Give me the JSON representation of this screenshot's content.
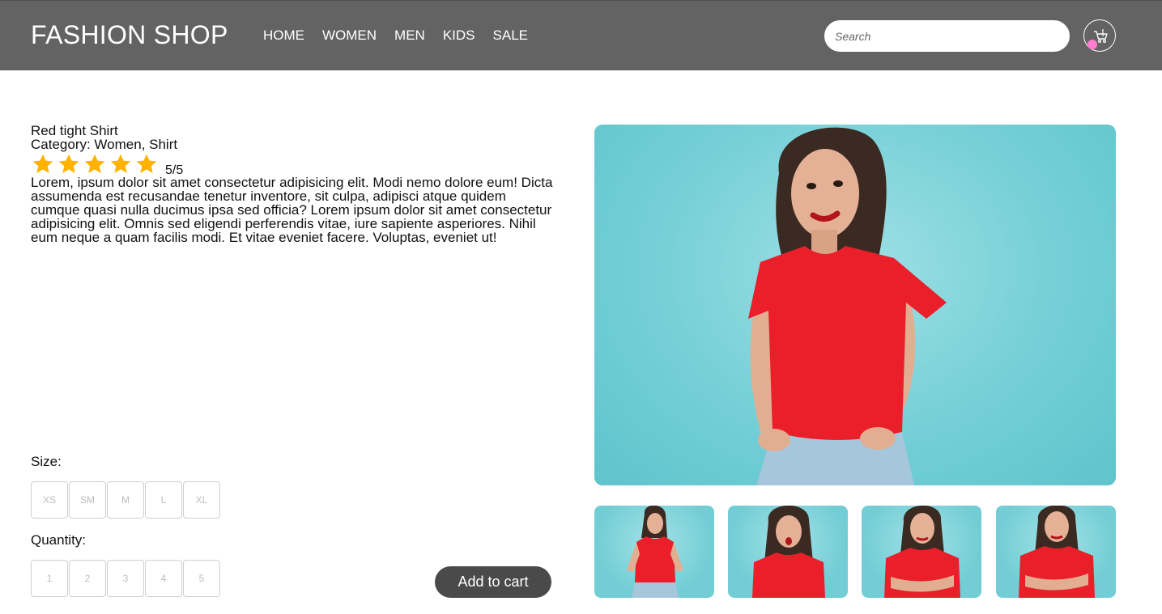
{
  "header": {
    "brand": "FASHION SHOP",
    "nav": [
      "HOME",
      "WOMEN",
      "MEN",
      "KIDS",
      "SALE"
    ],
    "search_placeholder": "Search",
    "cart_icon": "cart-icon",
    "colors": {
      "bar": "#636363",
      "cart_badge": "#ff7ccf"
    }
  },
  "product": {
    "name": "Red tight Shirt",
    "category": "Category: Women, Shirt",
    "rating": 5,
    "rating_max": 5,
    "rating_text": "5/5",
    "star_color": "#ffb300",
    "description": "Lorem, ipsum dolor sit amet consectetur adipisicing elit. Modi nemo dolore eum! Dicta assumenda est recusandae tenetur inventore, sit culpa, adipisci atque quidem cumque quasi nulla ducimus ipsa sed officia? Lorem ipsum dolor sit amet consectetur adipisicing elit. Omnis sed eligendi perferendis vitae, iure sapiente asperiores. Nihil eum neque a quam facilis modi. Et vitae eveniet facere. Voluptas, eveniet ut!"
  },
  "size": {
    "label": "Size:",
    "options": [
      "XS",
      "SM",
      "M",
      "L",
      "XL"
    ]
  },
  "quantity": {
    "label": "Quantity:",
    "options": [
      "1",
      "2",
      "3",
      "4",
      "5"
    ]
  },
  "add_to_cart": "Add to cart",
  "images": {
    "main": "woman in red t-shirt on teal background",
    "thumbnails": [
      "front pose",
      "surprised pose",
      "arms crossed",
      "arms crossed close"
    ]
  }
}
